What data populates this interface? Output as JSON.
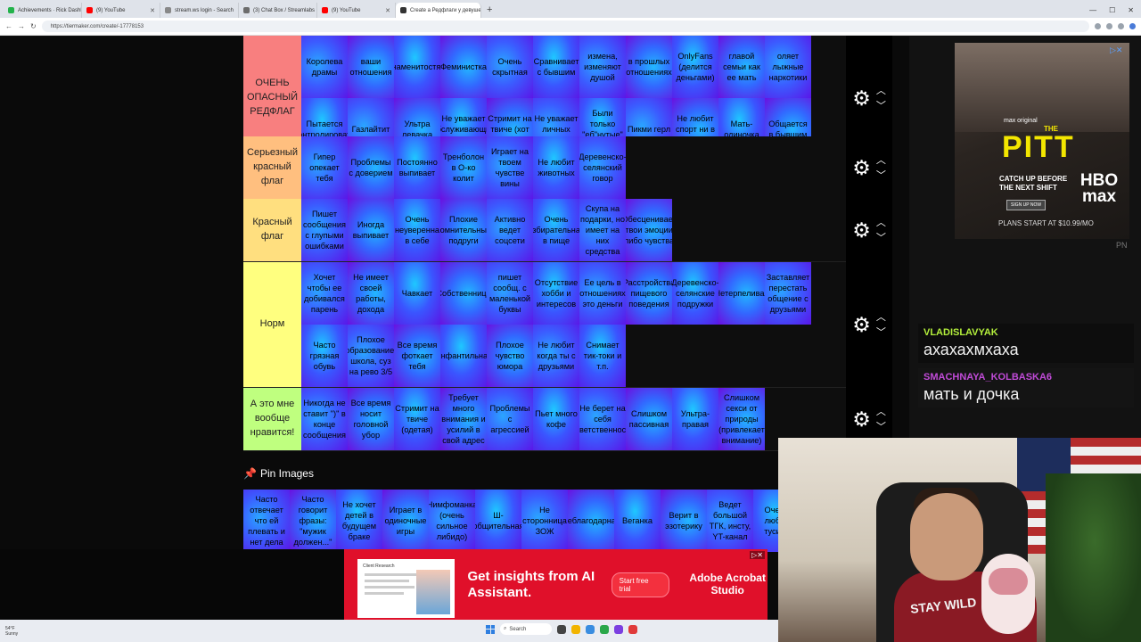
{
  "browser": {
    "tabs": [
      {
        "label": "Achievements · Rick Dashboard",
        "color": "#23b34b",
        "active": false
      },
      {
        "label": "(9) YouTube",
        "color": "#ff0000",
        "active": false
      },
      {
        "label": "stream.ws login - Search",
        "color": "#888888",
        "active": false
      },
      {
        "label": "(3) Chat Box / Streamlabs",
        "color": "#6c6c6c",
        "active": false
      },
      {
        "label": "(9) YouTube",
        "color": "#ff0000",
        "active": false
      },
      {
        "label": "Create a Редфлаги у девушек Ti...",
        "color": "#333333",
        "active": true
      }
    ],
    "url": "https://tiermaker.com/create/-17778153"
  },
  "tiers": [
    {
      "label": "ОЧЕНЬ ОПАСНЫЙ РЕДФЛАГ",
      "color": "#f87f7f",
      "items": [
        "Королева драмы",
        "ваши отношения",
        "знаменитостям",
        "Феминистка",
        "Очень скрытная",
        "Сравнивает с бывшим",
        "измена, изменяют душой",
        "в прошлых отношениях",
        "OnlyFans (делится деньгами)",
        "главой семьи как ее мать",
        "оляет лыжные наркотики",
        "Пытается контролировать",
        "Газлайтит",
        "Ультра левачка",
        "Не уважает обслуживающий персонал",
        "Стримит на твиче (хот табс)",
        "Не уважает личных границ",
        "Были только \"еб\"нутые\" бывшие",
        "Пикми герл",
        "Не любит спорт ни в каком виде",
        "Мать-одиночка",
        "Общается в бывшим"
      ]
    },
    {
      "label": "Серьезный красный флаг",
      "color": "#ffbf7f",
      "items": [
        "Гипер опекает тебя",
        "Проблемы с доверием",
        "Постоянно выпивает",
        "Тренболон в О-ко колит",
        "Играет на твоем чувстве вины",
        "Не любит животных",
        "Деревенско-селянский говор"
      ]
    },
    {
      "label": "Красный флаг",
      "color": "#ffdf7f",
      "items": [
        "Пишет сообщения с глупыми ошибками",
        "Иногда выпивает",
        "Очень неуверенна в себе",
        "Плохие (сомнительные) подруги",
        "Активно ведет соцсети",
        "Очень избирательная в пище",
        "Скупа на подарки, но имеет на них средства",
        "Обесценивает твои эмоции либо чувства"
      ]
    },
    {
      "label": "Норм",
      "color": "#ffff7f",
      "items": [
        "Хочет чтобы ее добивался парень",
        "Не имеет своей работы, дохода",
        "Чавкает",
        "Собственница",
        "пишет сообщ. с маленькой буквы",
        "Отсутствие хобби и интересов",
        "Ее цель в отношениях это деньги",
        "Расстройства пищевого поведения",
        "Деревенско-селянские подружки",
        "Нетерпеливая",
        "Заставляет перестать общение с друзьями",
        "Часто грязная обувь",
        "Плохое образование: школа, суз на рево 3/5",
        "Все время фоткает тебя",
        "Инфантильная",
        "Плохое чувство юмора",
        "Не любит когда ты с друзьями",
        "Снимает тик-токи и т.п."
      ]
    },
    {
      "label": "А это мне вообще нравится!",
      "color": "#bfff7f",
      "items": [
        "Никогда не ставит \")\" в конце сообщения",
        "Все время носит головной убор",
        "Стримит на твиче (одетая)",
        "Требует много внимания и усилий в свой адрес",
        "Проблемы с агрессией",
        "Пьет много кофе",
        "Не берет на себя ответственность",
        "Слишком пассивная",
        "Ультра-правая",
        "Слишком секси от природы (привлекает внимание)"
      ]
    }
  ],
  "pin": {
    "title": "Pin Images",
    "items": [
      "Часто отвечает что ей плевать и нет дела",
      "Часто говорит фразы: \"мужик должен...\"",
      "Не хочет детей в будущем браке",
      "Играет в одиночные игры",
      "Нимфоманка (очень сильное либидо)",
      "Ш-общительная",
      "Не сторонница ЗОЖ",
      "Неблагодарная",
      "Веганка",
      "Верит в эзотерику",
      "Ведет большой ТГК, инсту, YT-канал",
      "Очень любит тусить"
    ]
  },
  "ad_top": {
    "brand_small": "max original",
    "the": "THE",
    "title": "PITT",
    "catch": "CATCH UP BEFORE THE NEXT SHIFT",
    "signup": "SIGN UP NOW",
    "hbo": "HBO max",
    "plans": "PLANS START AT $10.99/MO",
    "corner": "PN"
  },
  "chat": [
    {
      "user": "VLADISLAVYAK",
      "text": "ахахахмхаха",
      "color": "#b4f03c"
    },
    {
      "user": "SMACHNAYA_KOLBASKA6",
      "text": "мать и дочка",
      "color": "#c14bd8"
    }
  ],
  "ad_bottom": {
    "screenshot_title": "Client Research",
    "headline": "Get insights from AI Assistant.",
    "cta": "Start free trial",
    "brand": "Adobe Acrobat Studio"
  },
  "webcam": {
    "shirt_text": "STAY WILD"
  },
  "taskbar": {
    "weather_temp": "54°F",
    "weather_desc": "Sunny",
    "search_placeholder": "Search"
  }
}
